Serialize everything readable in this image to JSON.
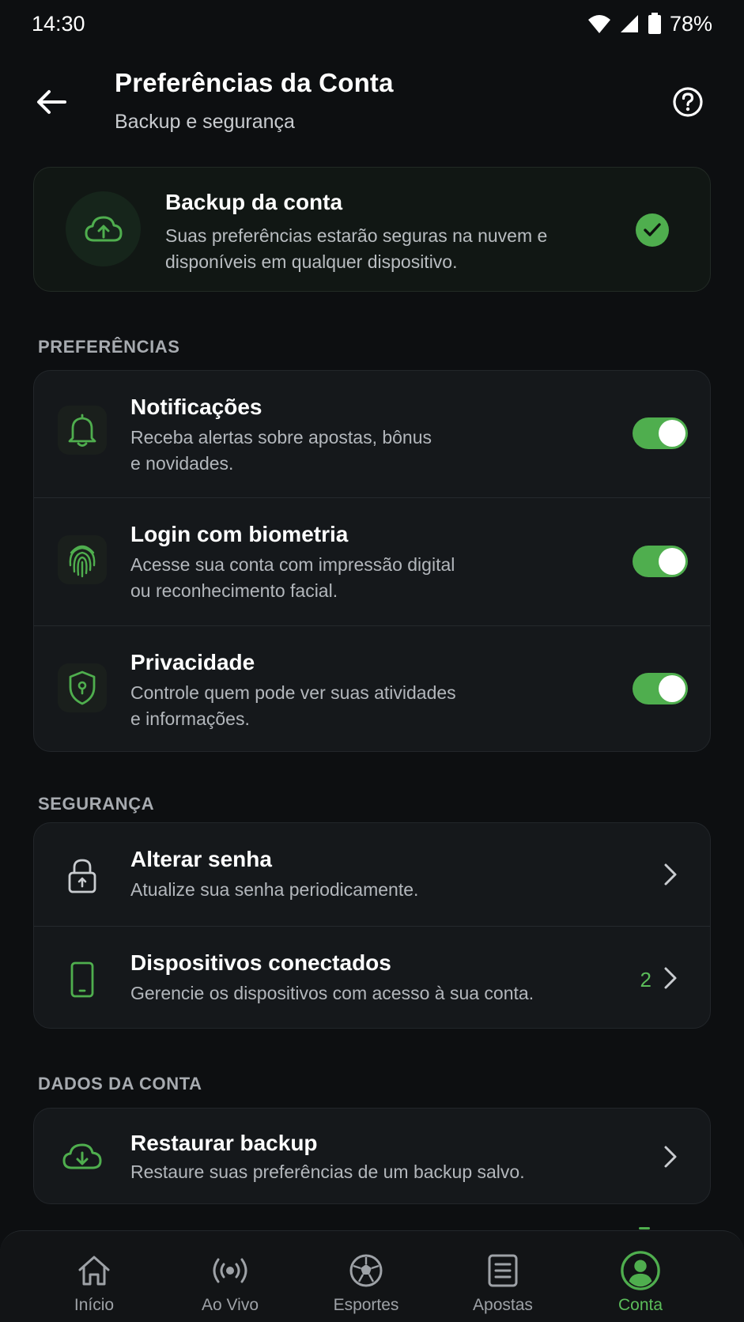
{
  "status_bar": {
    "time": "14:30",
    "battery": "78%"
  },
  "header": {
    "title": "Preferências da Conta",
    "subtitle": "Backup e segurança"
  },
  "backup_card": {
    "title": "Backup da conta",
    "description": "Suas preferências estarão seguras na nuvem e disponíveis em qualquer dispositivo.",
    "status": "checked"
  },
  "sections": {
    "preferences": {
      "label": "PREFERÊNCIAS",
      "items": [
        {
          "title": "Notificações",
          "description_line1": "Receba alertas sobre apostas, bônus",
          "description_line2": "e novidades.",
          "enabled": true
        },
        {
          "title": "Login com biometria",
          "description_line1": "Acesse sua conta com impressão digital",
          "description_line2": "ou reconhecimento facial.",
          "enabled": true
        },
        {
          "title": "Privacidade",
          "description_line1": "Controle quem pode ver suas atividades",
          "description_line2": "e informações.",
          "enabled": true
        }
      ]
    },
    "security": {
      "label": "SEGURANÇA",
      "items": [
        {
          "title": "Alterar senha",
          "description": "Atualize sua senha periodicamente."
        },
        {
          "title": "Dispositivos conectados",
          "description": "Gerencie os dispositivos com acesso à sua conta.",
          "count": "2"
        }
      ]
    },
    "account_data": {
      "label": "DADOS DA CONTA",
      "items": [
        {
          "title": "Restaurar backup",
          "description": "Restaure suas preferências de um backup salvo."
        }
      ]
    }
  },
  "bottom_nav": {
    "items": [
      {
        "label": "Início",
        "icon": "home-icon"
      },
      {
        "label": "Ao Vivo",
        "icon": "live-icon"
      },
      {
        "label": "Esportes",
        "icon": "soccer-ball-icon"
      },
      {
        "label": "Apostas",
        "icon": "bet-slip-icon"
      },
      {
        "label": "Conta",
        "icon": "account-icon",
        "active": true
      }
    ]
  },
  "colors": {
    "accent": "#4fae4e",
    "background": "#0d0f11",
    "card": "#15181b"
  }
}
